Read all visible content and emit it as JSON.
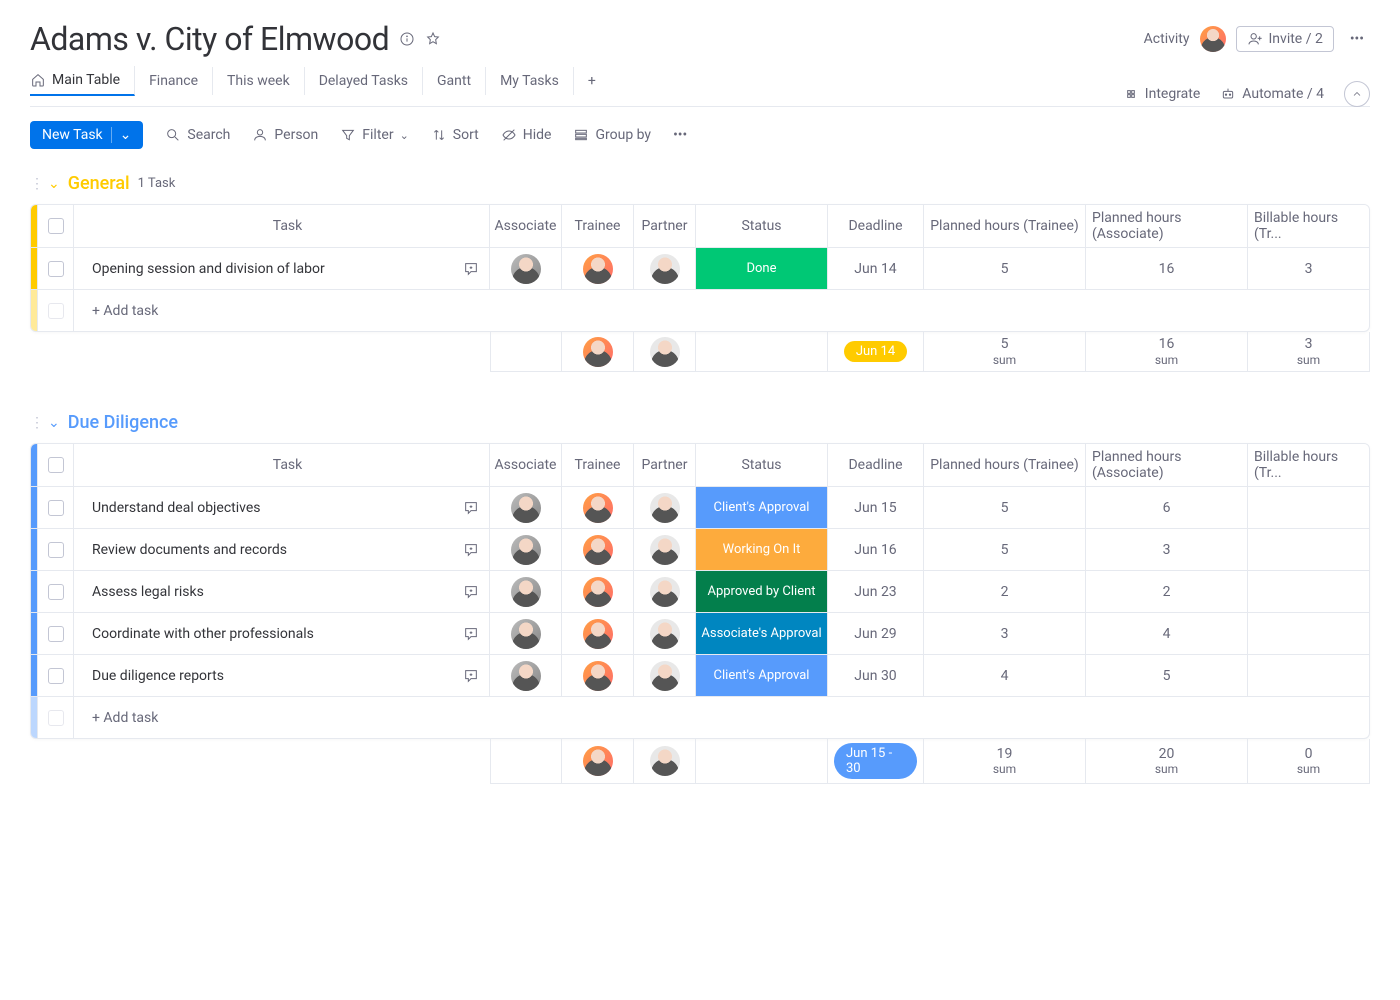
{
  "header": {
    "title": "Adams v. City of Elmwood",
    "activity": "Activity",
    "invite": "Invite / 2"
  },
  "tabs": {
    "items": [
      "Main Table",
      "Finance",
      "This week",
      "Delayed Tasks",
      "Gantt",
      "My Tasks"
    ],
    "active_index": 0,
    "integrate": "Integrate",
    "automate": "Automate / 4"
  },
  "toolbar": {
    "new_task": "New Task",
    "search": "Search",
    "person": "Person",
    "filter": "Filter",
    "sort": "Sort",
    "hide": "Hide",
    "group_by": "Group by"
  },
  "columns": {
    "task": "Task",
    "associate": "Associate",
    "trainee": "Trainee",
    "partner": "Partner",
    "status": "Status",
    "deadline": "Deadline",
    "planned_trainee": "Planned hours (Trainee)",
    "planned_associate": "Planned hours (Associate)",
    "billable_trainee": "Billable hours (Tr..."
  },
  "add_task": "+ Add task",
  "sum_label": "sum",
  "status_colors": {
    "Done": "#00c875",
    "Client's Approval": "#579bfc",
    "Working On It": "#fdab3d",
    "Approved by Client": "#037f4c",
    "Associate's Approval": "#0086c0"
  },
  "groups": [
    {
      "name": "General",
      "class": "general",
      "count": "1 Task",
      "rows": [
        {
          "task": "Opening session and division of labor",
          "status": "Done",
          "deadline": "Jun 14",
          "pt": "5",
          "pa": "16",
          "bt": "3"
        }
      ],
      "summary": {
        "deadline": "Jun 14",
        "pill": "yellow",
        "pt": "5",
        "pa": "16",
        "bt": "3"
      }
    },
    {
      "name": "Due Diligence",
      "class": "duedil",
      "count": "",
      "rows": [
        {
          "task": "Understand deal objectives",
          "status": "Client's Approval",
          "deadline": "Jun 15",
          "pt": "5",
          "pa": "6",
          "bt": ""
        },
        {
          "task": "Review documents and records",
          "status": "Working On It",
          "deadline": "Jun 16",
          "pt": "5",
          "pa": "3",
          "bt": ""
        },
        {
          "task": "Assess legal risks",
          "status": "Approved by Client",
          "deadline": "Jun 23",
          "pt": "2",
          "pa": "2",
          "bt": ""
        },
        {
          "task": "Coordinate with other professionals",
          "status": "Associate's Approval",
          "deadline": "Jun 29",
          "pt": "3",
          "pa": "4",
          "bt": ""
        },
        {
          "task": "Due diligence reports",
          "status": "Client's Approval",
          "deadline": "Jun 30",
          "pt": "4",
          "pa": "5",
          "bt": ""
        }
      ],
      "summary": {
        "deadline": "Jun 15 - 30",
        "pill": "blue",
        "pt": "19",
        "pa": "20",
        "bt": "0"
      }
    }
  ]
}
